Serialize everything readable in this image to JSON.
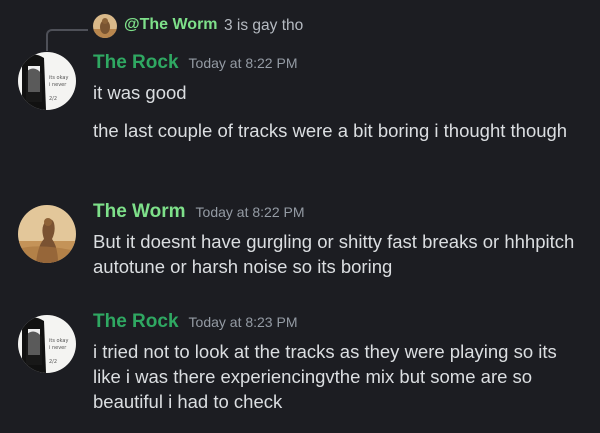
{
  "reply": {
    "author": "@The Worm",
    "text": "3 is gay tho"
  },
  "messages": [
    {
      "author": "The Rock",
      "time": "Today at 8:22 PM",
      "lines": [
        "it was good",
        "the last couple of tracks were a bit boring i thought though"
      ]
    },
    {
      "author": "The Worm",
      "time": "Today at 8:22 PM",
      "lines": [
        "But it doesnt have gurgling or shitty fast breaks or hhhpitch autotune or harsh noise so its boring"
      ]
    },
    {
      "author": "The Rock",
      "time": "Today at 8:23 PM",
      "lines": [
        "i tried not to look at the tracks as they were playing so its like i was there experiencingvthe mix but some are so beautiful i had to check"
      ]
    }
  ],
  "colors": {
    "background": "#1c1d22",
    "rock_name": "#2fa862",
    "worm_name": "#7ee08a",
    "text": "#dbdee1",
    "timestamp": "#949ba4"
  }
}
